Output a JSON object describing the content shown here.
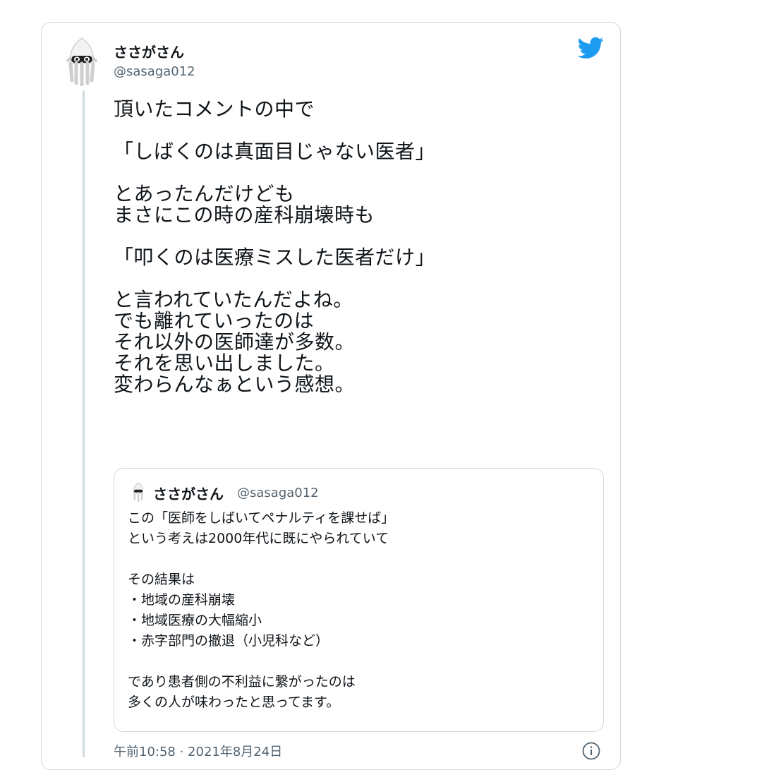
{
  "tweet": {
    "author_name": "ささがさん",
    "author_handle": "@sasaga012",
    "body": "頂いたコメントの中で\n\n「しばくのは真面目じゃない医者」\n\nとあったんだけども\nまさにこの時の産科崩壊時も\n\n「叩くのは医療ミスした医者だけ」\n\nと言われていたんだよね。\nでも離れていったのは\nそれ以外の医師達が多数。\nそれを思い出しました。\n変わらんなぁという感想。",
    "timestamp": "午前10:58 · 2021年8月24日"
  },
  "quote": {
    "author_name": "ささがさん",
    "author_handle": "@sasaga012",
    "body": "この「医師をしばいてペナルティを課せば」\nという考えは2000年代に既にやられていて\n\nその結果は\n・地域の産科崩壊\n・地域医療の大幅縮小\n・赤字部門の撤退（小児科など）\n\nであり患者側の不利益に繋がったのは\n多くの人が味わったと思ってます。"
  },
  "icons": {
    "brand": "twitter-bird-icon",
    "info": "info-icon",
    "avatar": "squid-avatar"
  },
  "colors": {
    "brand": "#1d9bf0",
    "text": "#0f1419",
    "secondary": "#536471",
    "border": "#cfd9de"
  }
}
